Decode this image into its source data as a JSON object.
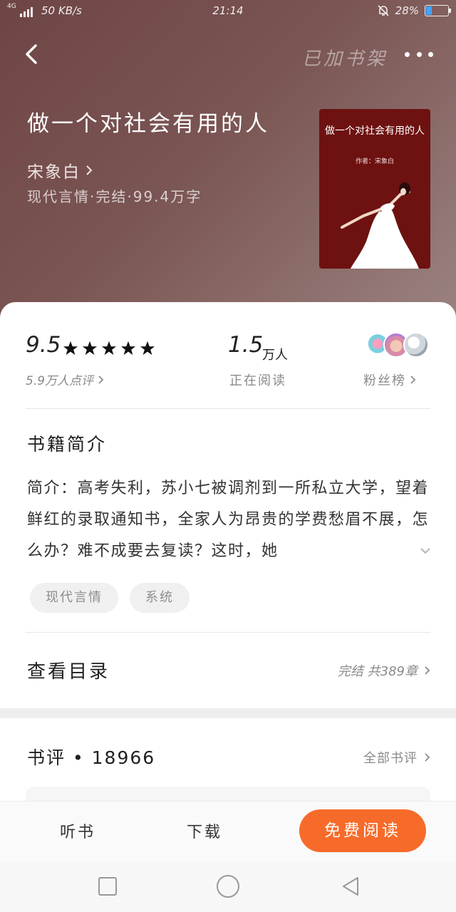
{
  "status_bar": {
    "network": "4G",
    "speed": "50 KB/s",
    "time": "21:14",
    "battery": "28%",
    "battery_level": 0.28
  },
  "header": {
    "shelf_label": "已加书架",
    "back_icon": "back-arrow-icon",
    "more_icon": "more-dots-icon"
  },
  "book": {
    "title": "做一个对社会有用的人",
    "author": "宋象白",
    "meta": "现代言情·完结·99.4万字",
    "cover": {
      "title": "做一个对社会有用的人",
      "author": "作者：宋象白",
      "bg_color": "#6d1211"
    }
  },
  "stats": {
    "score": "9.5",
    "stars": 5,
    "rating_count": "5.9万人点评",
    "reading_num": "1.5",
    "reading_unit": "万人",
    "reading_label": "正在阅读",
    "fans_label": "粉丝榜"
  },
  "intro": {
    "title": "书籍简介",
    "text": "简介：高考失利，苏小七被调剂到一所私立大学，望着鲜红的录取通知书，全家人为昂贵的学费愁眉不展，怎么办？难不成要去复读？这时，她",
    "tags": [
      "现代言情",
      "系统"
    ]
  },
  "catalog": {
    "label": "查看目录",
    "info": "完结 共389章"
  },
  "reviews": {
    "title": "书评 • 18966",
    "all_label": "全部书评"
  },
  "bottom_bar": {
    "listen": "听书",
    "download": "下载",
    "read": "免费阅读",
    "accent": "#f76b2a"
  }
}
